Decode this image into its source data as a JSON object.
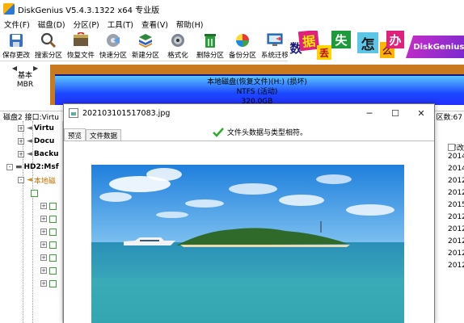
{
  "app": {
    "title": "DiskGenius V5.4.3.1322 x64 专业版"
  },
  "menu": [
    "文件(F)",
    "磁盘(D)",
    "分区(P)",
    "工具(T)",
    "查看(V)",
    "帮助(H)"
  ],
  "toolbar": [
    {
      "label": "保存更改",
      "icon": "save-icon"
    },
    {
      "label": "搜索分区",
      "icon": "search-partition-icon"
    },
    {
      "label": "恢复文件",
      "icon": "recover-files-icon"
    },
    {
      "label": "快速分区",
      "icon": "quick-partition-icon"
    },
    {
      "label": "新建分区",
      "icon": "new-partition-icon"
    },
    {
      "label": "格式化",
      "icon": "format-icon"
    },
    {
      "label": "删除分区",
      "icon": "delete-partition-icon"
    },
    {
      "label": "备份分区",
      "icon": "backup-partition-icon"
    },
    {
      "label": "系统迁移",
      "icon": "system-migration-icon"
    }
  ],
  "banner": {
    "chars": [
      "数",
      "据",
      "丢",
      "失",
      "怎",
      "么",
      "办"
    ],
    "brand": "DiskGenius"
  },
  "disk_left": {
    "line1": "基本",
    "line2": "MBR"
  },
  "partition": {
    "name": "本地磁盘(恢复文件)(H:) (损坏)",
    "fs": "NTFS (活动)",
    "size": "320.0GB"
  },
  "disk_info": "磁盘2 接口:Virtu",
  "disk_info_right": "区数:67",
  "tree": [
    {
      "indent": 24,
      "label": "Virtu",
      "color": "#000",
      "box": "+"
    },
    {
      "indent": 24,
      "label": "Docu",
      "color": "#000",
      "box": "+"
    },
    {
      "indent": 24,
      "label": "Backu",
      "color": "#000",
      "box": "+"
    },
    {
      "indent": 8,
      "label": "HD2:Msf",
      "color": "#000",
      "box": "-"
    },
    {
      "indent": 24,
      "label": "本地磁",
      "color": "#c07000",
      "box": "-"
    }
  ],
  "tree_chk_rows": 7,
  "right_panel": {
    "header": "修改",
    "rows": [
      "2014",
      "2014",
      "2012",
      "2012",
      "2015",
      "2012",
      "2012",
      "2012",
      "2012",
      "2012"
    ]
  },
  "dialog": {
    "title": "202103101517083.jpg",
    "tabs": [
      "预览",
      "文件数据"
    ],
    "status": "文件头数据与类型相符。",
    "minimize": "─",
    "maximize": "☐",
    "close": "✕"
  },
  "colors": {
    "partition_fill": "#1a48ff",
    "disk_outline": "#c97a1e",
    "status_ok": "#2eaa2e"
  }
}
